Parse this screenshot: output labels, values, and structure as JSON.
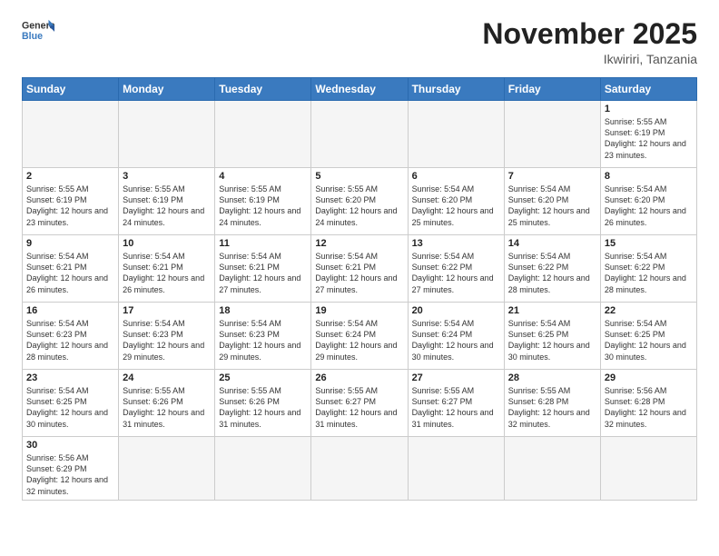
{
  "logo": {
    "text_general": "General",
    "text_blue": "Blue"
  },
  "header": {
    "month_title": "November 2025",
    "location": "Ikwiriri, Tanzania"
  },
  "weekdays": [
    "Sunday",
    "Monday",
    "Tuesday",
    "Wednesday",
    "Thursday",
    "Friday",
    "Saturday"
  ],
  "weeks": [
    [
      {
        "day": "",
        "info": ""
      },
      {
        "day": "",
        "info": ""
      },
      {
        "day": "",
        "info": ""
      },
      {
        "day": "",
        "info": ""
      },
      {
        "day": "",
        "info": ""
      },
      {
        "day": "",
        "info": ""
      },
      {
        "day": "1",
        "info": "Sunrise: 5:55 AM\nSunset: 6:19 PM\nDaylight: 12 hours and 23 minutes."
      }
    ],
    [
      {
        "day": "2",
        "info": "Sunrise: 5:55 AM\nSunset: 6:19 PM\nDaylight: 12 hours and 23 minutes."
      },
      {
        "day": "3",
        "info": "Sunrise: 5:55 AM\nSunset: 6:19 PM\nDaylight: 12 hours and 24 minutes."
      },
      {
        "day": "4",
        "info": "Sunrise: 5:55 AM\nSunset: 6:19 PM\nDaylight: 12 hours and 24 minutes."
      },
      {
        "day": "5",
        "info": "Sunrise: 5:55 AM\nSunset: 6:20 PM\nDaylight: 12 hours and 24 minutes."
      },
      {
        "day": "6",
        "info": "Sunrise: 5:54 AM\nSunset: 6:20 PM\nDaylight: 12 hours and 25 minutes."
      },
      {
        "day": "7",
        "info": "Sunrise: 5:54 AM\nSunset: 6:20 PM\nDaylight: 12 hours and 25 minutes."
      },
      {
        "day": "8",
        "info": "Sunrise: 5:54 AM\nSunset: 6:20 PM\nDaylight: 12 hours and 26 minutes."
      }
    ],
    [
      {
        "day": "9",
        "info": "Sunrise: 5:54 AM\nSunset: 6:21 PM\nDaylight: 12 hours and 26 minutes."
      },
      {
        "day": "10",
        "info": "Sunrise: 5:54 AM\nSunset: 6:21 PM\nDaylight: 12 hours and 26 minutes."
      },
      {
        "day": "11",
        "info": "Sunrise: 5:54 AM\nSunset: 6:21 PM\nDaylight: 12 hours and 27 minutes."
      },
      {
        "day": "12",
        "info": "Sunrise: 5:54 AM\nSunset: 6:21 PM\nDaylight: 12 hours and 27 minutes."
      },
      {
        "day": "13",
        "info": "Sunrise: 5:54 AM\nSunset: 6:22 PM\nDaylight: 12 hours and 27 minutes."
      },
      {
        "day": "14",
        "info": "Sunrise: 5:54 AM\nSunset: 6:22 PM\nDaylight: 12 hours and 28 minutes."
      },
      {
        "day": "15",
        "info": "Sunrise: 5:54 AM\nSunset: 6:22 PM\nDaylight: 12 hours and 28 minutes."
      }
    ],
    [
      {
        "day": "16",
        "info": "Sunrise: 5:54 AM\nSunset: 6:23 PM\nDaylight: 12 hours and 28 minutes."
      },
      {
        "day": "17",
        "info": "Sunrise: 5:54 AM\nSunset: 6:23 PM\nDaylight: 12 hours and 29 minutes."
      },
      {
        "day": "18",
        "info": "Sunrise: 5:54 AM\nSunset: 6:23 PM\nDaylight: 12 hours and 29 minutes."
      },
      {
        "day": "19",
        "info": "Sunrise: 5:54 AM\nSunset: 6:24 PM\nDaylight: 12 hours and 29 minutes."
      },
      {
        "day": "20",
        "info": "Sunrise: 5:54 AM\nSunset: 6:24 PM\nDaylight: 12 hours and 30 minutes."
      },
      {
        "day": "21",
        "info": "Sunrise: 5:54 AM\nSunset: 6:25 PM\nDaylight: 12 hours and 30 minutes."
      },
      {
        "day": "22",
        "info": "Sunrise: 5:54 AM\nSunset: 6:25 PM\nDaylight: 12 hours and 30 minutes."
      }
    ],
    [
      {
        "day": "23",
        "info": "Sunrise: 5:54 AM\nSunset: 6:25 PM\nDaylight: 12 hours and 30 minutes."
      },
      {
        "day": "24",
        "info": "Sunrise: 5:55 AM\nSunset: 6:26 PM\nDaylight: 12 hours and 31 minutes."
      },
      {
        "day": "25",
        "info": "Sunrise: 5:55 AM\nSunset: 6:26 PM\nDaylight: 12 hours and 31 minutes."
      },
      {
        "day": "26",
        "info": "Sunrise: 5:55 AM\nSunset: 6:27 PM\nDaylight: 12 hours and 31 minutes."
      },
      {
        "day": "27",
        "info": "Sunrise: 5:55 AM\nSunset: 6:27 PM\nDaylight: 12 hours and 31 minutes."
      },
      {
        "day": "28",
        "info": "Sunrise: 5:55 AM\nSunset: 6:28 PM\nDaylight: 12 hours and 32 minutes."
      },
      {
        "day": "29",
        "info": "Sunrise: 5:56 AM\nSunset: 6:28 PM\nDaylight: 12 hours and 32 minutes."
      }
    ],
    [
      {
        "day": "30",
        "info": "Sunrise: 5:56 AM\nSunset: 6:29 PM\nDaylight: 12 hours and 32 minutes."
      },
      {
        "day": "",
        "info": ""
      },
      {
        "day": "",
        "info": ""
      },
      {
        "day": "",
        "info": ""
      },
      {
        "day": "",
        "info": ""
      },
      {
        "day": "",
        "info": ""
      },
      {
        "day": "",
        "info": ""
      }
    ]
  ]
}
